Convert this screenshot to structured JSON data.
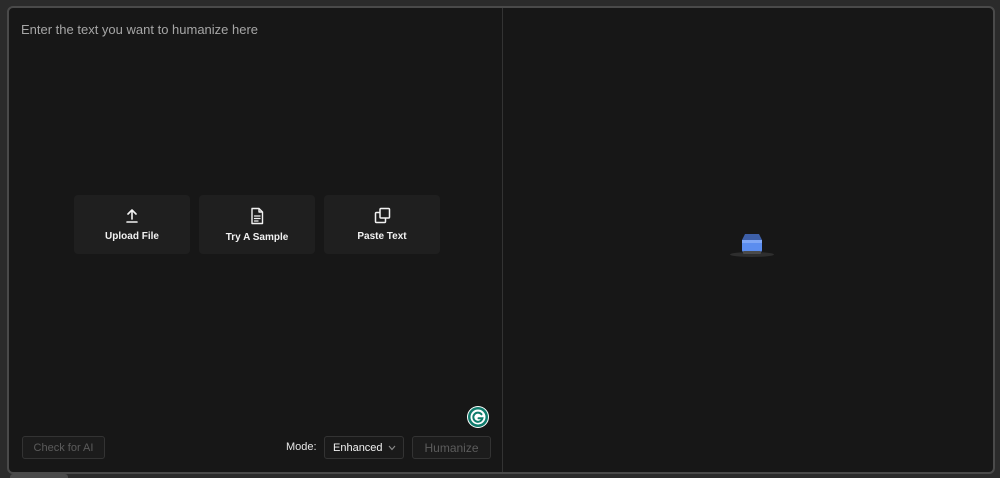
{
  "input": {
    "placeholder": "Enter the text you want to humanize here",
    "value": ""
  },
  "actions": [
    {
      "label": "Upload File",
      "icon": "upload-icon"
    },
    {
      "label": "Try A Sample",
      "icon": "document-icon"
    },
    {
      "label": "Paste Text",
      "icon": "copy-icon"
    }
  ],
  "toolbar": {
    "check_ai_label": "Check for AI",
    "mode_label": "Mode:",
    "mode_value": "Enhanced",
    "humanize_label": "Humanize"
  },
  "output": {
    "empty_state_icon": "inbox-icon"
  },
  "extension": {
    "icon": "grammarly-icon"
  },
  "colors": {
    "background": "#171717",
    "border": "#4a4a4a",
    "accent_blue": "#5b8def",
    "grammarly_green": "#15c39a"
  }
}
